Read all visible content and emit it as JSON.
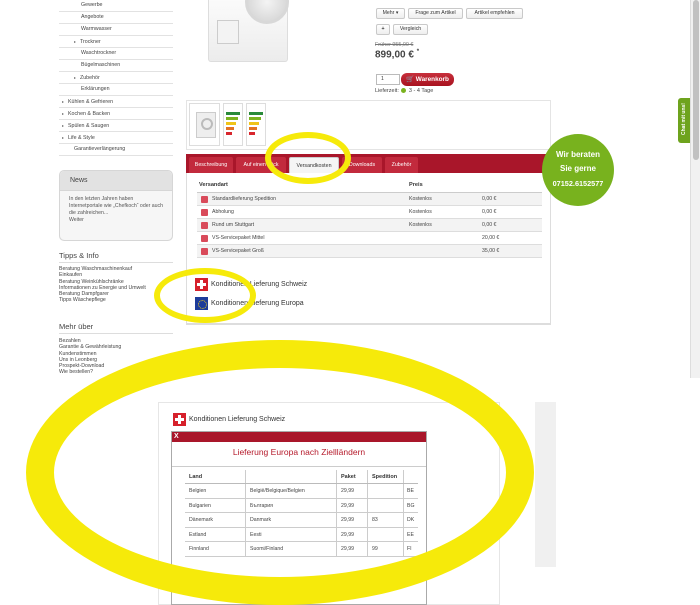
{
  "sidebar": {
    "categories": [
      {
        "label": "Gewerbe",
        "level": "sub"
      },
      {
        "label": "Angebote",
        "level": "sub"
      },
      {
        "label": "Warmwasser",
        "level": "sub"
      },
      {
        "label": "Trockner",
        "level": "sub2",
        "expandable": true
      },
      {
        "label": "Waschtrockner",
        "level": "sub"
      },
      {
        "label": "Bügelmaschinen",
        "level": "sub"
      },
      {
        "label": "Zubehör",
        "level": "sub2",
        "expandable": true
      },
      {
        "label": "Erklärungen",
        "level": "sub"
      },
      {
        "label": "Kühlen & Gefrieren",
        "level": "main",
        "expandable": true
      },
      {
        "label": "Kochen & Backen",
        "level": "main",
        "expandable": true
      },
      {
        "label": "Spülen & Saugen",
        "level": "main",
        "expandable": true
      },
      {
        "label": "Life & Style",
        "level": "main",
        "expandable": true
      },
      {
        "label": "Garantieverlängerung",
        "level": "sub2"
      }
    ],
    "news": {
      "title": "News",
      "text": "In den letzten Jahren haben Internetportale wie „Chefkoch“ oder auch die zahlreichen...",
      "more": "Weiter"
    },
    "tips": {
      "title": "Tipps & Info",
      "links": [
        "Beratung Waschmaschinenkauf",
        "Einkaufen",
        "Beratung Weinkühlschränke",
        "Informationen zu Energie und Umwelt",
        "Beratung Dampfgarer",
        "Tipps Wäschepflege"
      ]
    },
    "more": {
      "title": "Mehr über",
      "links": [
        "Bezahlen",
        "Garantie & Gewährleistung",
        "Kundenstimmen",
        "Uns in Leonberg",
        "Prospekt-Download",
        "Wie bestellen?"
      ]
    }
  },
  "product": {
    "buttons": {
      "mehr": "Mehr ▾",
      "frage": "Frage zum Artikel",
      "empfehlen": "Artikel empfehlen",
      "plus": "+",
      "vergleich": "Vergleich"
    },
    "old_price": "Früher 955,00 €",
    "price": "899,00 €",
    "price_mark": "*",
    "quantity": "1",
    "cart_label": "Warenkorb",
    "delivery_label": "Lieferzeit:",
    "delivery_value": "3 - 4 Tage"
  },
  "tabs": [
    {
      "label": "Beschreibung"
    },
    {
      "label": "Auf einen Blick"
    },
    {
      "label": "Versandkosten",
      "active": true
    },
    {
      "label": "Downloads"
    },
    {
      "label": "Zubehör"
    }
  ],
  "shipping": {
    "col_name": "Versandart",
    "col_price": "Preis",
    "rows": [
      {
        "name": "Standardlieferung Spedition",
        "price": "Kostenlos",
        "cost": "0,00 €"
      },
      {
        "name": "Abholung",
        "price": "Kostenlos",
        "cost": "0,00 €"
      },
      {
        "name": "Rund um Stuttgart",
        "price": "Kostenlos",
        "cost": "0,00 €"
      },
      {
        "name": "VS-Servicepaket Mittel",
        "price": "",
        "cost": "20,00 €"
      },
      {
        "name": "VS-Servicepaket Groß",
        "price": "",
        "cost": "35,00 €"
      }
    ],
    "cond_ch": "Konditionen Lieferung Schweiz",
    "cond_eu": "Konditionen Lieferung Europa"
  },
  "chat": {
    "label": "Chat mit uns!"
  },
  "badge": {
    "line1": "Wir beraten",
    "line2": "Sie gerne",
    "phone": "07152.6152577"
  },
  "dialog": {
    "cond_ch": "Konditionen Lieferung Schweiz",
    "close": "X",
    "title": "Lieferung Europa nach Ziellländern",
    "headers": {
      "land": "Land",
      "paket": "Paket",
      "spedition": "Spedition"
    },
    "rows": [
      {
        "land": "Belgien",
        "local": "Belgiё/Belgique/Belgien",
        "paket": "29,99",
        "spedition": "",
        "code": "BE"
      },
      {
        "land": "Bulgarien",
        "local": "България",
        "paket": "29,99",
        "spedition": "",
        "code": "BG"
      },
      {
        "land": "Dänemark",
        "local": "Danmark",
        "paket": "29,99",
        "spedition": "83",
        "code": "DK"
      },
      {
        "land": "Estland",
        "local": "Eesti",
        "paket": "29,99",
        "spedition": "",
        "code": "EE"
      },
      {
        "land": "Finnland",
        "local": "Suomi/Finland",
        "paket": "29,99",
        "spedition": "99",
        "code": "FI"
      }
    ]
  },
  "colors": {
    "brand_red": "#a9162a",
    "accent_green": "#78b21e",
    "highlight_yellow": "#f6ea0a"
  }
}
